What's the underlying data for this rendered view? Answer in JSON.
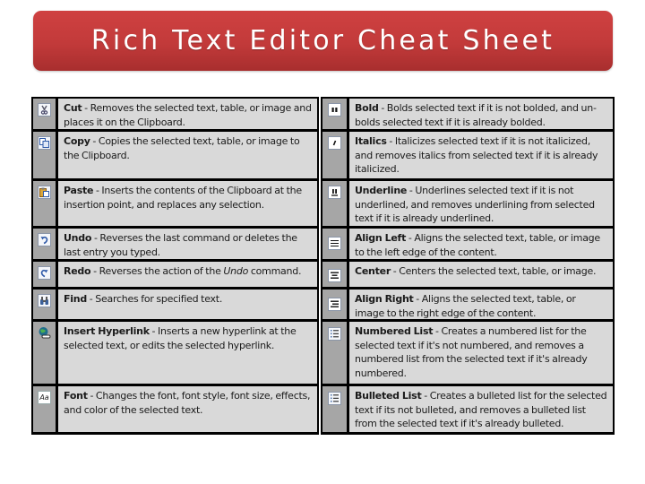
{
  "title": "Rich Text Editor Cheat Sheet",
  "left_column": [
    {
      "icon": "cut-icon",
      "term": "Cut",
      "desc": " - Removes the selected text, table, or image and places it on the Clipboard."
    },
    {
      "icon": "copy-icon",
      "term": "Copy",
      "desc": " - Copies the selected text, table, or image to the Clipboard."
    },
    {
      "icon": "paste-icon",
      "term": "Paste",
      "desc": " - Inserts the contents of the Clipboard at the insertion point, and replaces any selection."
    },
    {
      "icon": "undo-icon",
      "term": "Undo",
      "desc": " - Reverses the last command or deletes the last entry you typed."
    },
    {
      "icon": "redo-icon",
      "term": "Redo",
      "desc_before": " - Reverses the action of the ",
      "desc_italic": "Undo",
      "desc_after": " command."
    },
    {
      "icon": "find-icon",
      "term": "Find",
      "desc": " - Searches for specified text."
    },
    {
      "icon": "hyperlink-icon",
      "term": "Insert Hyperlink",
      "desc": " - Inserts a new hyperlink at the selected text, or edits the selected hyperlink."
    },
    {
      "icon": "font-icon",
      "icon_text": "Aa",
      "term": "Font",
      "desc": " - Changes the font, font style, font size, effects, and color of the selected text."
    }
  ],
  "right_column": [
    {
      "icon": "bold-icon",
      "term": "Bold",
      "desc": " - Bolds selected text if it is not bolded, and un-bolds selected text if it is already bolded."
    },
    {
      "icon": "italic-icon",
      "term": "Italics",
      "desc": " - Italicizes selected text if it is not italicized, and removes italics from selected text if it is already italicized."
    },
    {
      "icon": "underline-icon",
      "term": "Underline",
      "desc": " - Underlines selected text if it is not underlined, and removes underlining from selected text if it is already underlined."
    },
    {
      "icon": "align-left-icon",
      "term": "Align Left",
      "desc": " - Aligns the selected text, table, or image to the left edge of the content."
    },
    {
      "icon": "align-center-icon",
      "term": "Center",
      "desc": " - Centers the selected text, table, or image."
    },
    {
      "icon": "align-right-icon",
      "term": "Align Right",
      "desc": " - Aligns the selected text, table, or image to the right edge of the content."
    },
    {
      "icon": "numbered-list-icon",
      "term": "Numbered List",
      "desc": " - Creates a numbered list for the selected text if it's not numbered, and removes a numbered list from the selected text if it's already numbered."
    },
    {
      "icon": "bulleted-list-icon",
      "term": "Bulleted List",
      "desc": " - Creates a bulleted list for the selected text if its not bulleted, and removes a bulleted list from the selected text if it's already bulleted."
    }
  ],
  "colors": {
    "banner": "#c23a3a",
    "icon_column": "#a6a6a6",
    "text_column": "#d9d9d9",
    "border": "#000000"
  }
}
